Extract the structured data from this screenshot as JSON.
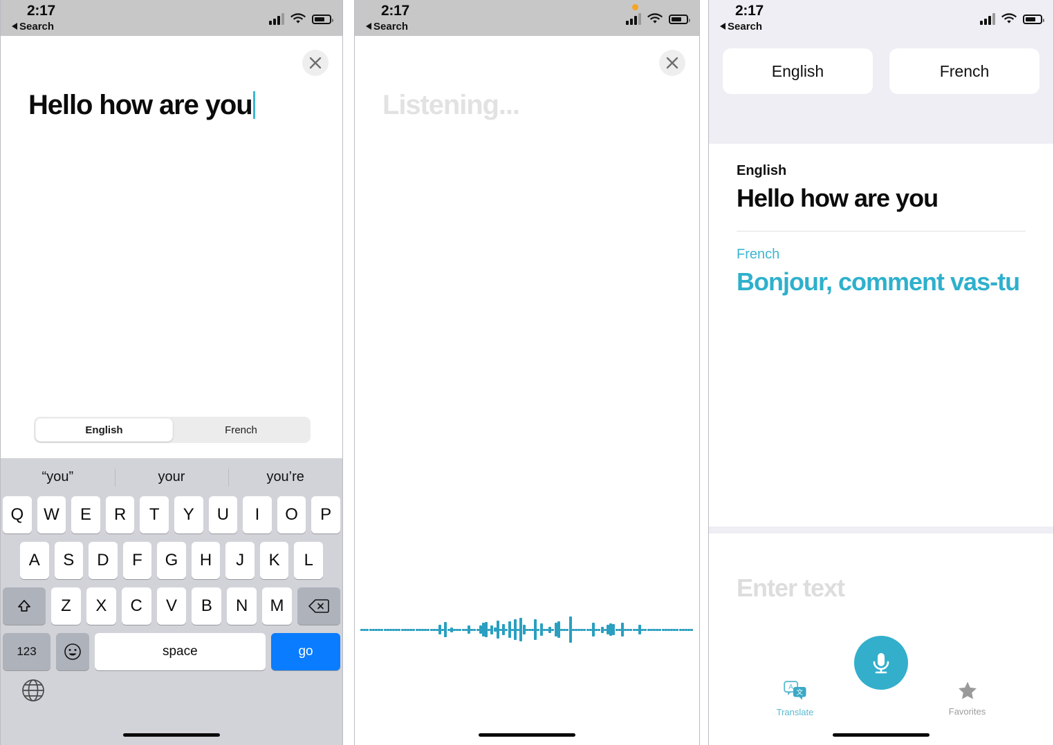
{
  "status_bar": {
    "time": "2:17",
    "back_label": "Search",
    "signal_icon": "cellular-signal-icon",
    "wifi_icon": "wifi-icon",
    "battery_icon": "battery-icon",
    "recording_indicator": "recording-dot-icon"
  },
  "colors": {
    "teal": "#33afcc",
    "teal_text": "#2eb0cc",
    "waveform": "#2a9fc0",
    "keyboard_bg": "#d1d3d9",
    "go_key_blue": "#0a7cff",
    "panel3_bg": "#eeeef4",
    "recording_dot": "#f5a623"
  },
  "panel1": {
    "close_icon": "close-icon",
    "typed_text": "Hello how are you",
    "segmented": {
      "options": [
        "English",
        "French"
      ],
      "selected": "English"
    },
    "keyboard": {
      "suggestions": [
        "“you”",
        "your",
        "you’re"
      ],
      "row1": [
        "Q",
        "W",
        "E",
        "R",
        "T",
        "Y",
        "U",
        "I",
        "O",
        "P"
      ],
      "row2": [
        "A",
        "S",
        "D",
        "F",
        "G",
        "H",
        "J",
        "K",
        "L"
      ],
      "row3": [
        "Z",
        "X",
        "C",
        "V",
        "B",
        "N",
        "M"
      ],
      "shift_icon": "shift-arrow-icon",
      "backspace_icon": "backspace-icon",
      "numbers_key": "123",
      "emoji_icon": "emoji-smiley-icon",
      "space_key": "space",
      "go_key": "go",
      "globe_icon": "globe-icon"
    }
  },
  "panel2": {
    "close_icon": "close-icon",
    "listening_text": "Listening...",
    "waveform_heights": [
      3,
      3,
      3,
      3,
      3,
      3,
      3,
      3,
      3,
      3,
      3,
      3,
      3,
      3,
      3,
      3,
      3,
      3,
      3,
      3,
      3,
      3,
      3,
      3,
      3,
      3,
      3,
      14,
      3,
      22,
      3,
      7,
      3,
      3,
      3,
      3,
      3,
      12,
      3,
      3,
      3,
      12,
      20,
      22,
      3,
      13,
      6,
      26,
      3,
      16,
      3,
      24,
      3,
      30,
      3,
      34,
      14,
      3,
      3,
      3,
      30,
      3,
      18,
      3,
      3,
      9,
      3,
      20,
      24,
      3,
      3,
      3,
      38,
      3,
      3,
      3,
      3,
      3,
      3,
      3,
      20,
      3,
      3,
      9,
      3,
      14,
      18,
      16,
      3,
      3,
      20,
      3,
      3,
      3,
      3,
      3,
      14,
      3,
      3,
      3,
      3,
      3,
      3,
      3,
      3,
      3,
      3,
      3,
      3,
      3,
      3,
      3,
      3,
      3,
      3
    ]
  },
  "panel3": {
    "languages": {
      "source": "English",
      "target": "French"
    },
    "result": {
      "source_label": "English",
      "source_text": "Hello how are you",
      "target_label": "French",
      "target_text": "Bonjour, comment vas-tu"
    },
    "input": {
      "placeholder": "Enter text",
      "mic_icon": "microphone-icon"
    },
    "tabs": [
      {
        "label": "Translate",
        "icon": "translate-bubbles-icon",
        "active": true
      },
      {
        "label": "Favorites",
        "icon": "star-icon",
        "active": false
      }
    ]
  }
}
